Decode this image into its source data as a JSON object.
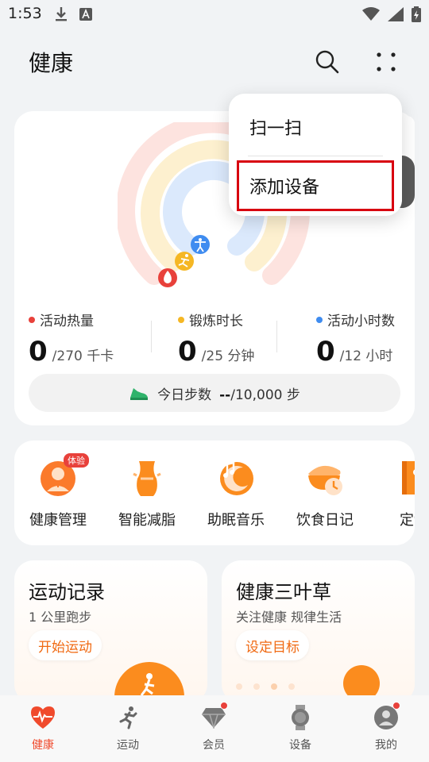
{
  "status_bar": {
    "time": "1:53"
  },
  "header": {
    "title": "健康",
    "search_icon": "search-icon",
    "menu_icon": "more-grid-icon"
  },
  "activity": {
    "calories": {
      "label": "活动热量",
      "value": "0",
      "goal": "/270 千卡",
      "color": "#e8413b"
    },
    "exercise": {
      "label": "锻炼时长",
      "value": "0",
      "goal": "/25 分钟",
      "color": "#f5b724"
    },
    "active_hours": {
      "label": "活动小时数",
      "value": "0",
      "goal": "/12 小时",
      "color": "#3f8cf0"
    },
    "steps": {
      "label": "今日步数",
      "value": "--",
      "goal": "/10,000 步"
    }
  },
  "services": [
    {
      "label": "健康管理",
      "badge": "体验"
    },
    {
      "label": "智能减脂"
    },
    {
      "label": "助眠音乐"
    },
    {
      "label": "饮食日记"
    },
    {
      "label": "定制"
    }
  ],
  "promo_cards": [
    {
      "title": "运动记录",
      "subtitle": "1 公里跑步",
      "button": "开始运动"
    },
    {
      "title": "健康三叶草",
      "subtitle": "关注健康 规律生活",
      "button": "设定目标"
    }
  ],
  "tabs": [
    {
      "label": "健康",
      "active": true
    },
    {
      "label": "运动"
    },
    {
      "label": "会员",
      "dot": true
    },
    {
      "label": "设备"
    },
    {
      "label": "我的",
      "dot": true
    }
  ],
  "popup_menu": {
    "items": [
      {
        "label": "扫一扫"
      },
      {
        "label": "添加设备",
        "highlighted": true
      }
    ]
  }
}
